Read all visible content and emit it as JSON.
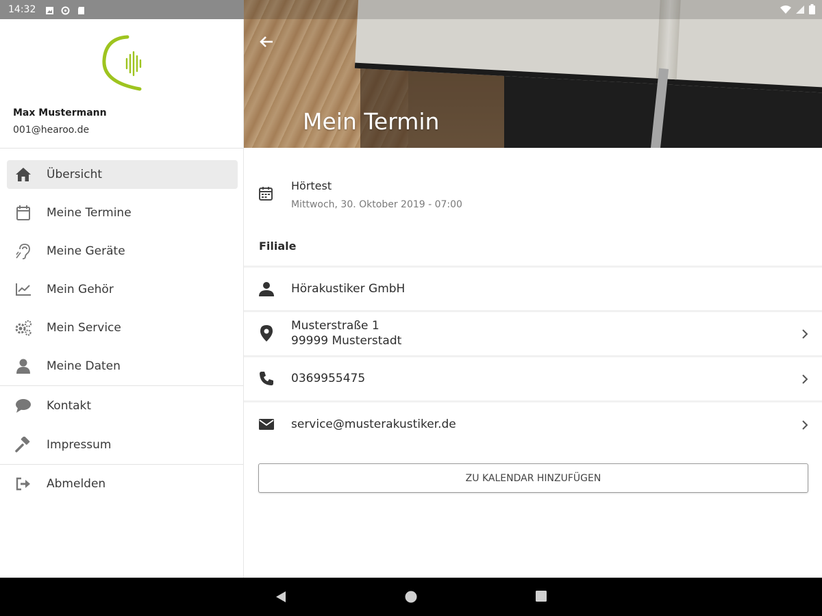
{
  "status_bar": {
    "time": "14:32"
  },
  "user": {
    "name": "Max Mustermann",
    "email": "001@hearoo.de"
  },
  "nav": {
    "items": [
      {
        "label": "Übersicht",
        "icon": "home-icon"
      },
      {
        "label": "Meine Termine",
        "icon": "calendar-icon"
      },
      {
        "label": "Meine Geräte",
        "icon": "hearing-icon"
      },
      {
        "label": "Mein Gehör",
        "icon": "chart-icon"
      },
      {
        "label": "Mein Service",
        "icon": "gears-icon"
      },
      {
        "label": "Meine Daten",
        "icon": "user-icon"
      },
      {
        "label": "Kontakt",
        "icon": "chat-icon"
      },
      {
        "label": "Impressum",
        "icon": "gavel-icon"
      },
      {
        "label": "Abmelden",
        "icon": "logout-icon"
      }
    ]
  },
  "header": {
    "title": "Mein Termin"
  },
  "appointment": {
    "title": "Hörtest",
    "date": "Mittwoch, 30. Oktober 2019 - 07:00"
  },
  "branch": {
    "section_label": "Filiale",
    "name": "Hörakustiker GmbH",
    "street": "Musterstraße 1",
    "city": "99999 Musterstadt",
    "phone": "0369955475",
    "email": "service@musterakustiker.de"
  },
  "actions": {
    "add_to_calendar": "ZU KALENDAR HINZUFÜGEN"
  },
  "colors": {
    "brand_green": "#9ec41f",
    "active_item_bg": "#ebebeb"
  }
}
